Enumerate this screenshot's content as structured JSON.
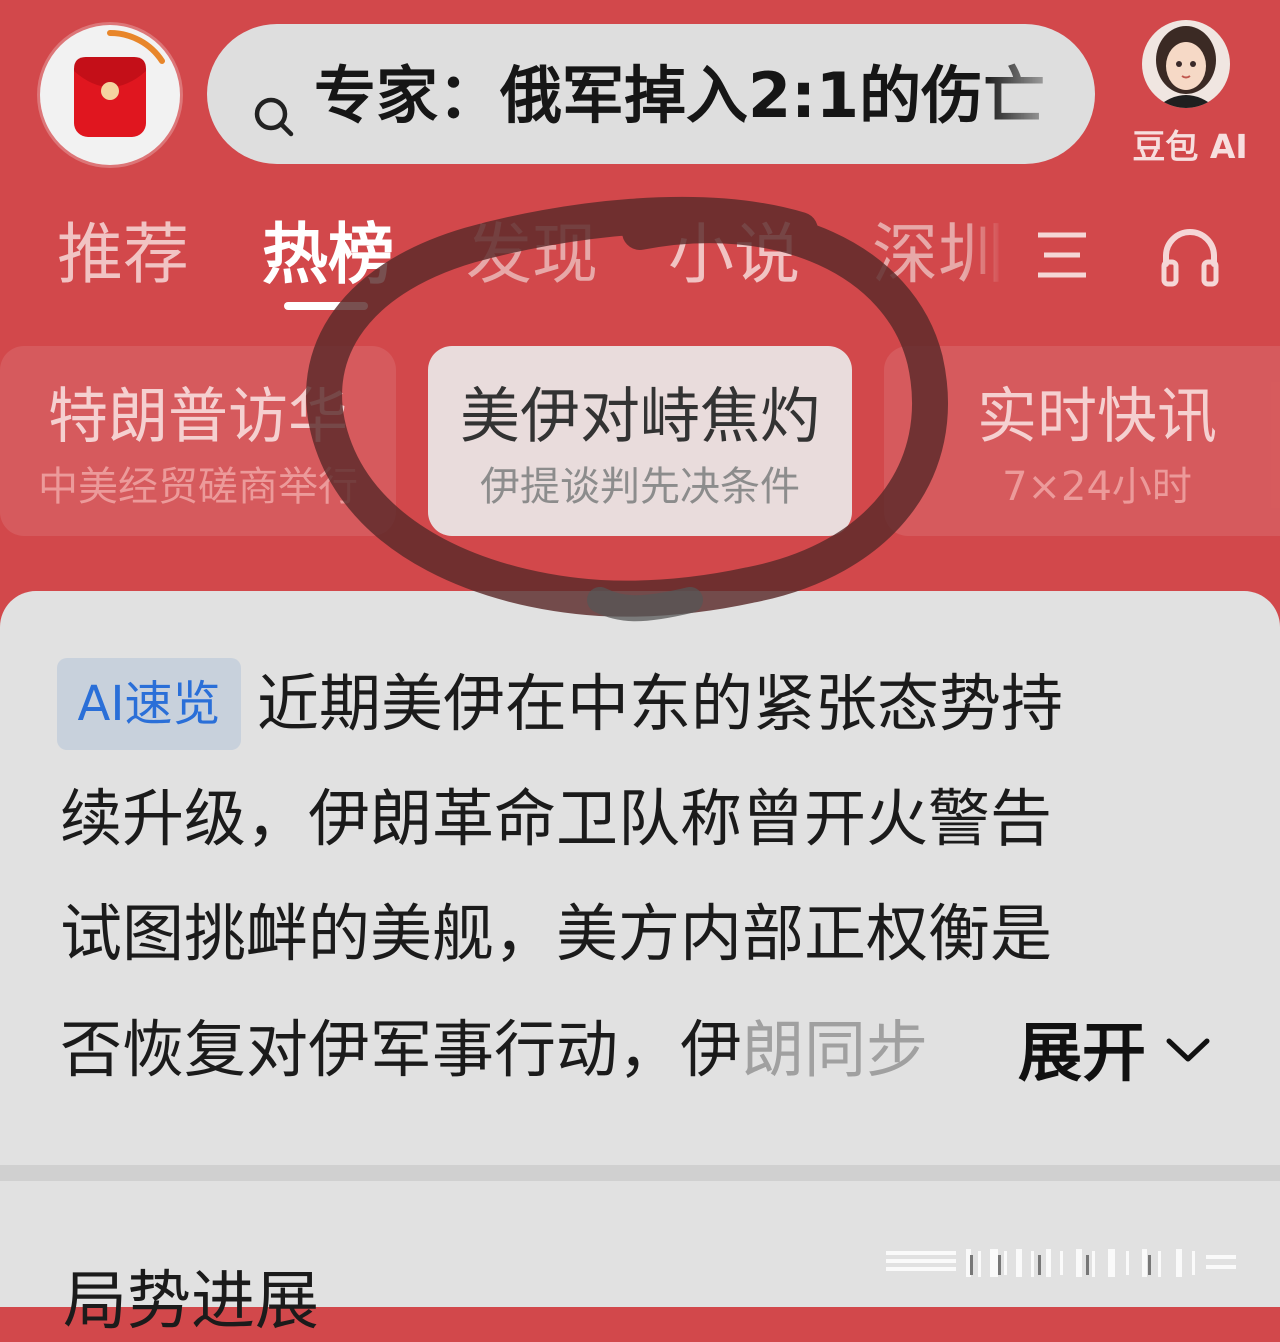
{
  "header": {
    "search_query": "专家：俄军掉入2:1的伤亡",
    "avatar_label": "豆包 AI",
    "icons": [
      "red-packet-icon",
      "search-icon",
      "doubao-avatar"
    ]
  },
  "tabs": [
    {
      "label": "推荐"
    },
    {
      "label": "热榜",
      "active": true
    },
    {
      "label": "发现"
    },
    {
      "label": "小说"
    },
    {
      "label": "深圳"
    }
  ],
  "topics": [
    {
      "title": "特朗普访华",
      "subtitle": "中美经贸磋商举行"
    },
    {
      "title": "美伊对峙焦灼",
      "subtitle": "伊提谈判先决条件",
      "selected": true
    },
    {
      "title": "实时快讯",
      "subtitle": "7×24小时"
    }
  ],
  "summary": {
    "badge": "AI速览",
    "lines": [
      "近期美伊在中东的紧张态势持",
      "续升级，伊朗革命卫队称曾开火警告",
      "试图挑衅的美舰，美方内部正权衡是",
      "否恢复对伊军事行动，伊朗同步"
    ],
    "expand_label": "展开"
  },
  "section": {
    "title": "局势进展"
  },
  "colors": {
    "header_bg": "#d2484b",
    "card_bg": "#e1e1e1",
    "badge_text": "#2a6fd8",
    "annotation": "#5a2a2a"
  }
}
